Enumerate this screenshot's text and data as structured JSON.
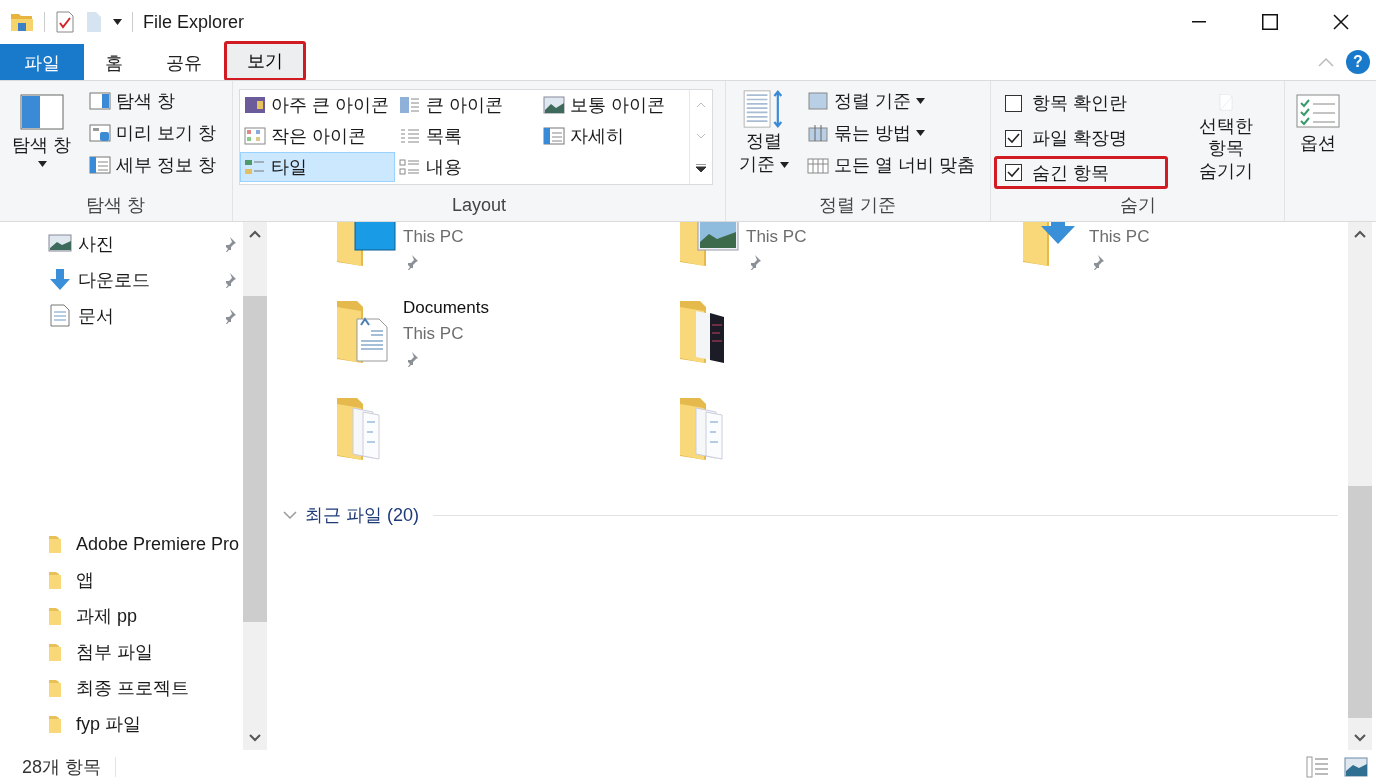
{
  "window": {
    "title": "File Explorer"
  },
  "ribbon_tabs": [
    {
      "label": "파일",
      "kind": "file",
      "selected": false,
      "highlighted": false
    },
    {
      "label": "홈",
      "kind": "tab",
      "selected": false,
      "highlighted": false
    },
    {
      "label": "공유",
      "kind": "tab",
      "selected": false,
      "highlighted": false
    },
    {
      "label": "보기",
      "kind": "tab",
      "selected": true,
      "highlighted": true
    }
  ],
  "help": {
    "label": "?"
  },
  "ribbon": {
    "pane_group": {
      "label": "탐색 창",
      "big_button": {
        "label": "탐색 창",
        "dropdown": true
      },
      "buttons": [
        {
          "label": "탐색 창",
          "kind": "nav"
        },
        {
          "label": "미리 보기 창",
          "kind": "preview"
        },
        {
          "label": "세부 정보 창",
          "kind": "details"
        }
      ]
    },
    "layout_group": {
      "label": "Layout",
      "options": [
        {
          "label": "아주 큰 아이콘",
          "kind": "xl",
          "selected": false
        },
        {
          "label": "큰 아이콘",
          "kind": "large",
          "selected": false
        },
        {
          "label": "보통 아이콘",
          "kind": "medium",
          "selected": false
        },
        {
          "label": "작은 아이콘",
          "kind": "small",
          "selected": false
        },
        {
          "label": "목록",
          "kind": "list",
          "selected": false
        },
        {
          "label": "자세히",
          "kind": "details",
          "selected": false
        },
        {
          "label": "타일",
          "kind": "tiles",
          "selected": true
        },
        {
          "label": "내용",
          "kind": "content",
          "selected": false
        }
      ]
    },
    "sort_group": {
      "label": "정렬 기준",
      "big_button": {
        "label": "정렬 기준",
        "dropdown": true
      },
      "buttons": [
        {
          "label": "정렬 기준",
          "kind": "sort",
          "dropdown": true
        },
        {
          "label": "묶는 방법",
          "kind": "group",
          "dropdown": true
        },
        {
          "label": "모든 열 너비 맞춤",
          "kind": "fit",
          "dropdown": false
        }
      ]
    },
    "hide_group": {
      "label": "숨기",
      "checkboxes": [
        {
          "label": "항목 확인란",
          "checked": false,
          "highlighted": false
        },
        {
          "label": "파일 확장명",
          "checked": true,
          "highlighted": false
        },
        {
          "label": "숨긴 항목",
          "checked": true,
          "highlighted": true
        }
      ],
      "big_button": {
        "label": "선택한 항목 숨기기"
      }
    },
    "options_button": {
      "label": "옵션"
    }
  },
  "sidebar": {
    "pinned": [
      {
        "label": "사진",
        "kind": "pictures",
        "pinned": true
      },
      {
        "label": "다운로드",
        "kind": "downloads",
        "pinned": true
      },
      {
        "label": "문서",
        "kind": "documents",
        "pinned": true
      }
    ],
    "folders": [
      {
        "label": "Adobe Premiere Pro"
      },
      {
        "label": "앱"
      },
      {
        "label": "과제 pp"
      },
      {
        "label": "첨부 파일"
      },
      {
        "label": "최종 프로젝트"
      },
      {
        "label": "fyp 파일"
      }
    ]
  },
  "content": {
    "tile_rows": [
      [
        {
          "subtitle": "This PC",
          "pinned": true,
          "kind": "desktop"
        },
        {
          "subtitle": "This PC",
          "pinned": true,
          "kind": "pictures"
        },
        {
          "subtitle": "This PC",
          "pinned": true,
          "kind": "downloads"
        }
      ],
      [
        {
          "title": "Documents",
          "subtitle": "This PC",
          "pinned": true,
          "kind": "documents"
        },
        {
          "kind": "dark-docs"
        }
      ],
      [
        {
          "kind": "docs"
        },
        {
          "kind": "docs"
        }
      ]
    ],
    "section": {
      "label": "최근 파일 (20)",
      "expanded": true
    }
  },
  "status_bar": {
    "item_count": "28개 항목"
  }
}
